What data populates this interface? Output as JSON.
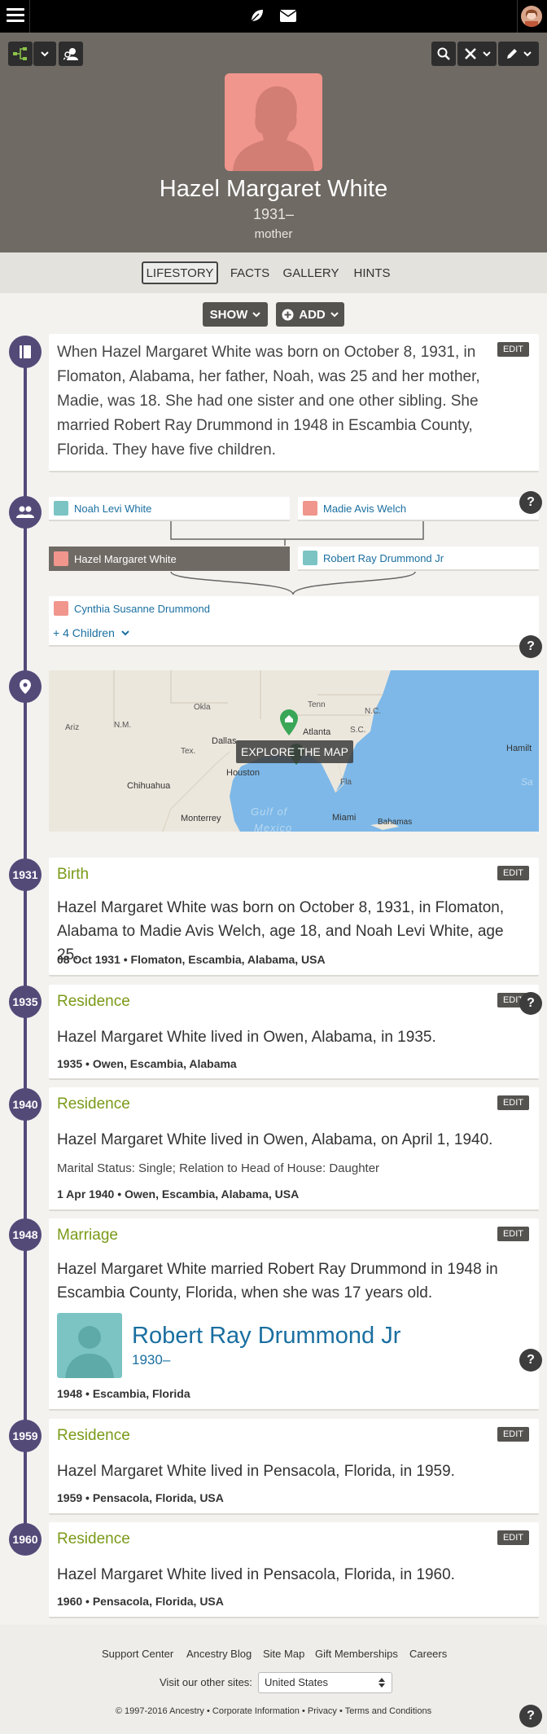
{
  "colors": {
    "accent": "#534a78",
    "event_title": "#7a9a18",
    "link": "#1a6fa0",
    "female": "#f0968d",
    "male": "#7cc4c4"
  },
  "person": {
    "name": "Hazel Margaret White",
    "years": "1931–",
    "relation": "mother"
  },
  "tabs": [
    "LIFESTORY",
    "FACTS",
    "GALLERY",
    "HINTS"
  ],
  "actions": {
    "show": "SHOW",
    "add": "ADD"
  },
  "story": {
    "edit": "EDIT",
    "text": "When Hazel Margaret White was born on October 8, 1931, in Flomaton, Alabama, her father, Noah, was 25 and her mother, Madie, was 18. She had one sister and one other sibling. She married Robert Ray Drummond in 1948 in Escambia County, Florida. They have five children."
  },
  "family": {
    "father": "Noah Levi White",
    "mother": "Madie Avis Welch",
    "self": "Hazel Margaret White",
    "spouse": "Robert Ray Drummond Jr",
    "child": "Cynthia Susanne Drummond",
    "more_children": "+ 4 Children"
  },
  "map": {
    "button": "EXPLORE THE MAP",
    "labels": [
      "Okla",
      "Tenn",
      "N.C.",
      "Ariz",
      "N.M.",
      "S.C.",
      "Atlanta",
      "Tex.",
      "Dallas",
      "Houston",
      "Chihuahua",
      "Monterrey",
      "Fla",
      "Hamilt",
      "Gulf of",
      "Mexico",
      "Miami",
      "Bahamas",
      "Sa"
    ]
  },
  "events": [
    {
      "year": "1931",
      "title": "Birth",
      "desc": "Hazel Margaret White was born on October 8, 1931, in Flomaton, Alabama to Madie Avis Welch, age 18, and Noah Levi White, age 25.",
      "meta": "08 Oct 1931 • Flomaton, Escambia, Alabama, USA",
      "edit": "EDIT"
    },
    {
      "year": "1935",
      "title": "Residence",
      "desc": "Hazel Margaret White lived in Owen, Alabama, in 1935.",
      "meta": "1935 • Owen, Escambia, Alabama",
      "edit": "EDIT"
    },
    {
      "year": "1940",
      "title": "Residence",
      "desc": "Hazel Margaret White lived in Owen, Alabama, on April 1, 1940.",
      "sub": "Marital Status: Single; Relation to Head of House: Daughter",
      "meta": "1 Apr 1940 • Owen, Escambia, Alabama, USA",
      "edit": "EDIT"
    },
    {
      "year": "1948",
      "title": "Marriage",
      "desc": "Hazel Margaret White married Robert Ray Drummond in 1948 in Escambia County, Florida, when she was 17 years old.",
      "spouse_name": "Robert Ray Drummond Jr",
      "spouse_years": "1930–",
      "meta": "1948 • Escambia, Florida",
      "edit": "EDIT"
    },
    {
      "year": "1959",
      "title": "Residence",
      "desc": "Hazel Margaret White lived in Pensacola, Florida, in 1959.",
      "meta": "1959 • Pensacola, Florida, USA",
      "edit": "EDIT"
    },
    {
      "year": "1960",
      "title": "Residence",
      "desc": "Hazel Margaret White lived in Pensacola, Florida, in 1960.",
      "meta": "1960 • Pensacola, Florida, USA",
      "edit": "EDIT"
    }
  ],
  "help": "?",
  "footer": {
    "links": [
      "Support Center",
      "Ancestry Blog",
      "Site Map",
      "Gift Memberships",
      "Careers"
    ],
    "visit_label": "Visit our other sites:",
    "site_select": "United States",
    "copyright": "© 1997-2016 Ancestry",
    "legal": [
      "Corporate Information",
      "Privacy",
      "Terms and Conditions"
    ]
  }
}
